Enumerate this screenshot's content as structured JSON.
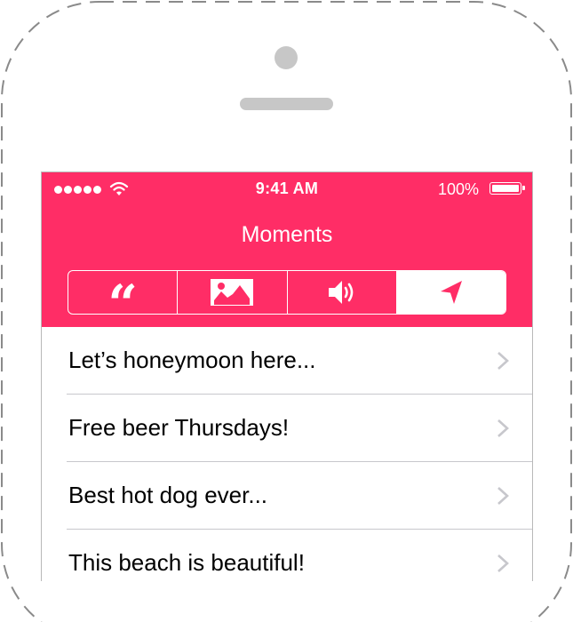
{
  "status_bar": {
    "time": "9:41 AM",
    "battery": "100%"
  },
  "navbar": {
    "title": "Moments"
  },
  "segments": [
    {
      "icon": "quote-icon",
      "glyph": "“"
    },
    {
      "icon": "photo-icon"
    },
    {
      "icon": "speaker-icon"
    },
    {
      "icon": "location-arrow-icon",
      "selected": true
    }
  ],
  "list": {
    "items": [
      {
        "label": "Let’s honeymoon here..."
      },
      {
        "label": "Free beer Thursdays!"
      },
      {
        "label": "Best hot dog ever..."
      },
      {
        "label": "This beach is beautiful!"
      }
    ]
  },
  "colors": {
    "accent": "#ff2d66",
    "separator": "#c8c7cc",
    "chevron": "#c7c7cc",
    "hardware": "#c7c7c7"
  }
}
